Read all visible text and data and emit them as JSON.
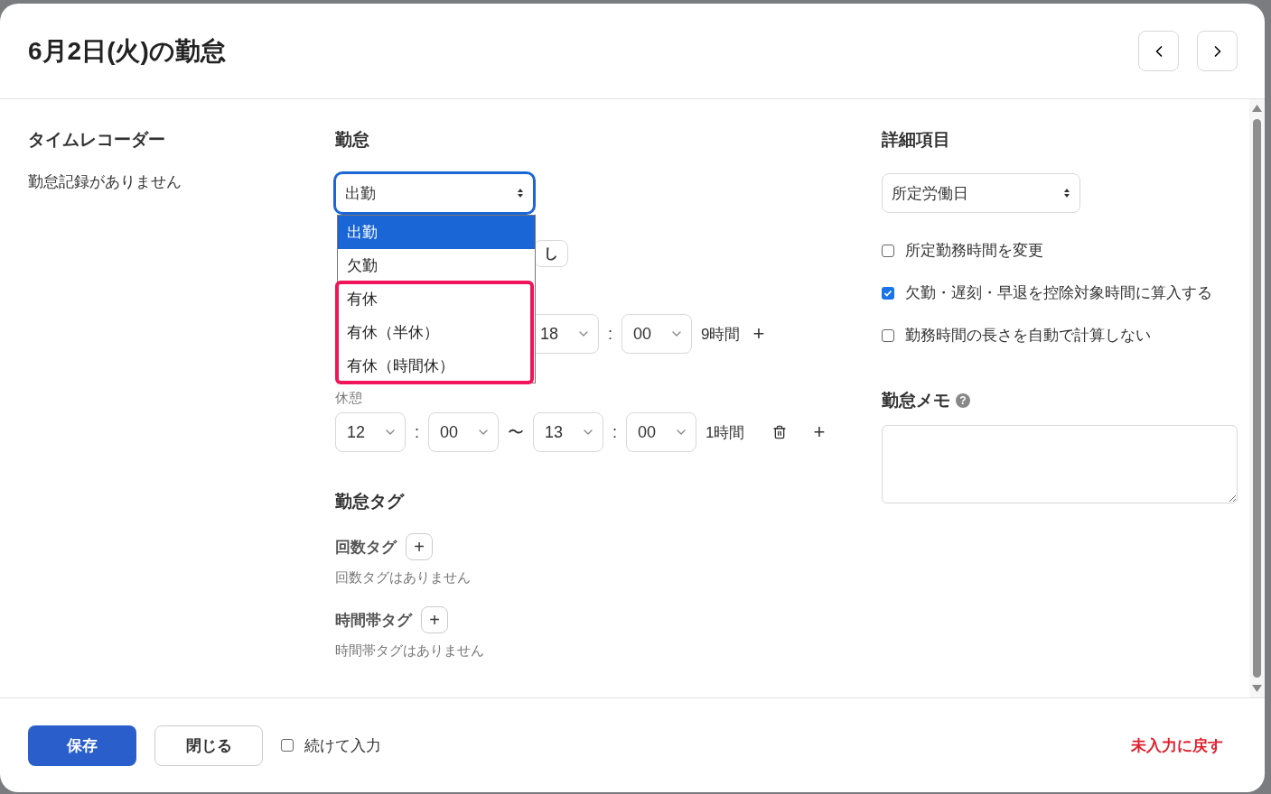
{
  "dialog": {
    "title": "6月2日(火)の勤怠",
    "nav": [
      {
        "kind": "prev"
      },
      {
        "kind": "next"
      }
    ]
  },
  "time_recorder": {
    "heading": "タイムレコーダー",
    "empty": "勤怠記録がありません"
  },
  "attendance": {
    "heading": "勤怠",
    "select": {
      "value": "出勤",
      "expanded": true
    },
    "options": [
      {
        "label": "出勤",
        "selected": true,
        "highlighted": false
      },
      {
        "label": "欠勤",
        "selected": false,
        "highlighted": false
      },
      {
        "label": "有休",
        "selected": false,
        "highlighted": true
      },
      {
        "label": "有休（半休）",
        "selected": false,
        "highlighted": true
      },
      {
        "label": "有休（時間休）",
        "selected": false,
        "highlighted": true
      }
    ],
    "partial_button": "し",
    "work_row": {
      "end_hour": "18",
      "colon": ":",
      "end_minute": "00",
      "duration": "9時間",
      "add": "+"
    },
    "break_label": "休憩",
    "break_row": {
      "start_hour": "12",
      "colon1": ":",
      "start_minute": "00",
      "tilde": "〜",
      "end_hour": "13",
      "colon2": ":",
      "end_minute": "00",
      "duration": "1時間",
      "add": "+"
    }
  },
  "tags": {
    "heading": "勤怠タグ",
    "groups": [
      {
        "label": "回数タグ",
        "add": "+",
        "empty": "回数タグはありません"
      },
      {
        "label": "時間帯タグ",
        "add": "+",
        "empty": "時間帯タグはありません"
      }
    ]
  },
  "details": {
    "heading": "詳細項目",
    "select": {
      "value": "所定労働日"
    },
    "checks": [
      {
        "label": "所定勤務時間を変更",
        "checked": false
      },
      {
        "label": "欠勤・遅刻・早退を控除対象時間に算入する",
        "checked": true
      },
      {
        "label": "勤務時間の長さを自動で計算しない",
        "checked": false
      }
    ],
    "memo": {
      "heading": "勤怠メモ",
      "help": "?"
    }
  },
  "footer": {
    "save": "保存",
    "close": "閉じる",
    "continue": {
      "label": "続けて入力",
      "checked": false
    },
    "reset": "未入力に戻す"
  }
}
